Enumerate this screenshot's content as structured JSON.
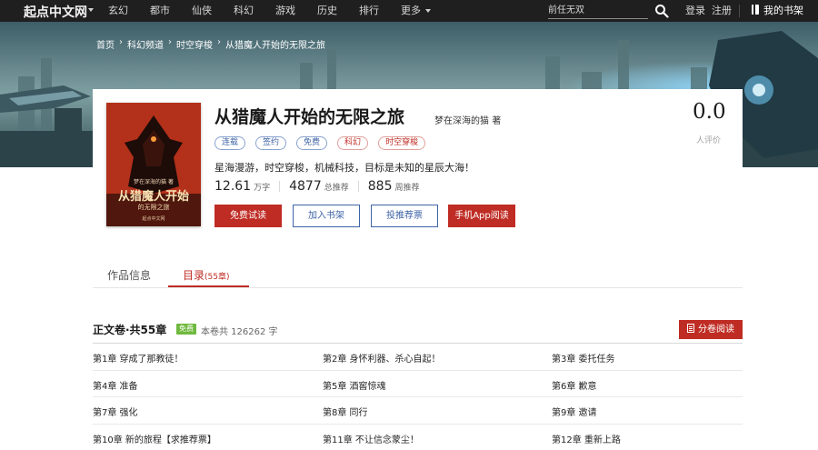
{
  "topbar": {
    "logo": "起点中文网",
    "nav": [
      "玄幻",
      "都市",
      "仙侠",
      "科幻",
      "游戏",
      "历史",
      "排行",
      "更多"
    ],
    "search_value": "前任无双",
    "login": "登录",
    "register": "注册",
    "shelf": "我的书架"
  },
  "breadcrumb": [
    "首页",
    "科幻频道",
    "时空穿梭",
    "从猎魔人开始的无限之旅"
  ],
  "book": {
    "title": "从猎魔人开始的无限之旅",
    "author": "梦在深海的猫",
    "author_suffix": "著",
    "cover_author": "梦在深海的猫 著",
    "cover_title_line1": "从猎魔人开始",
    "cover_title_line2": "的无限之旅",
    "cover_publisher": "起点中文网",
    "tags": [
      {
        "label": "连载",
        "color": "blue"
      },
      {
        "label": "签约",
        "color": "blue"
      },
      {
        "label": "免费",
        "color": "blue"
      },
      {
        "label": "科幻",
        "color": "red"
      },
      {
        "label": "时空穿梭",
        "color": "red"
      }
    ],
    "intro": "星海漫游，时空穿梭，机械科技，目标是未知的星辰大海！",
    "stats": {
      "words": "12.61",
      "words_unit": "万字",
      "total_rec": "4877",
      "total_rec_unit": "总推荐",
      "week_rec": "885",
      "week_rec_unit": "周推荐"
    },
    "buttons": {
      "free_read": "免费试读",
      "add_shelf": "加入书架",
      "vote": "投推荐票",
      "app_read": "手机App阅读"
    },
    "score": "0.0",
    "score_label": "人评价"
  },
  "tabs": {
    "info": "作品信息",
    "catalog": "目录",
    "catalog_count": "(55章)"
  },
  "volume": {
    "title": "正文卷·共55章",
    "free_badge": "免费",
    "info": "本卷共 126262 字",
    "read_button": "分卷阅读"
  },
  "chapters": [
    "第1章 穿成了那教徒！",
    "第2章 身怀利器、杀心自起！",
    "第3章 委托任务",
    "第4章 准备",
    "第5章 酒窖惊魂",
    "第6章 歉意",
    "第7章 强化",
    "第8章 同行",
    "第9章 邀请",
    "第10章 新的旅程【求推荐票】",
    "第11章 不让信念蒙尘！",
    "第12章 重新上路"
  ],
  "colors": {
    "accent_red": "#bf2c24",
    "accent_blue": "#3f64a6",
    "free_green": "#70b93f",
    "topbar_bg": "#1f1f1f"
  }
}
